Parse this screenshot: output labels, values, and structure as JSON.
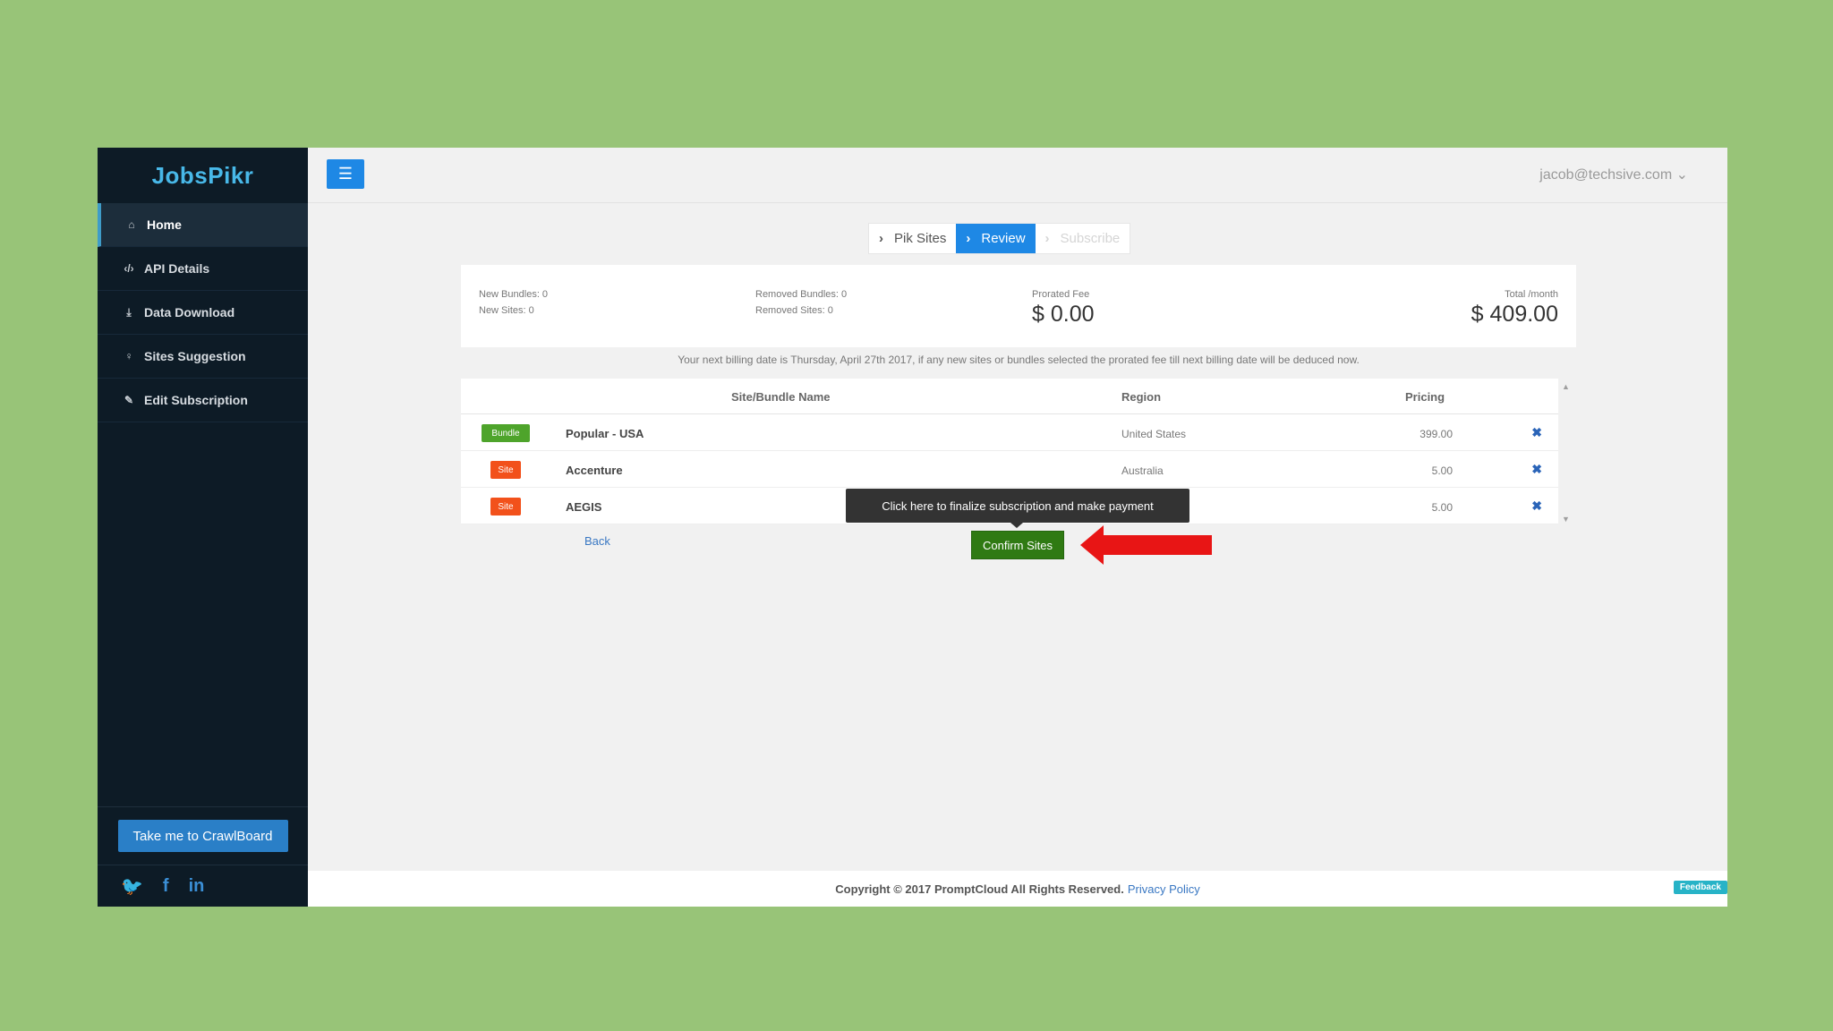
{
  "sidebar": {
    "logo": "JobsPikr",
    "items": [
      {
        "label": "Home",
        "icon": "home-icon",
        "glyph": "⌂"
      },
      {
        "label": "API Details",
        "icon": "code-icon",
        "glyph": "‹/›"
      },
      {
        "label": "Data Download",
        "icon": "download-icon",
        "glyph": "⤓"
      },
      {
        "label": "Sites Suggestion",
        "icon": "lightbulb-icon",
        "glyph": "♀"
      },
      {
        "label": "Edit Subscription",
        "icon": "edit-icon",
        "glyph": "✎"
      }
    ],
    "crawlboard_button": "Take me to CrawlBoard",
    "social": {
      "twitter": "🐦",
      "facebook": "f",
      "linkedin": "in"
    }
  },
  "topbar": {
    "menu_icon": "☰",
    "user": "jacob@techsive.com ⌄"
  },
  "steps": [
    {
      "label": "Pik Sites",
      "state": "done"
    },
    {
      "label": "Review",
      "state": "active"
    },
    {
      "label": "Subscribe",
      "state": "disabled"
    }
  ],
  "summary": {
    "new_bundles": "New Bundles: 0",
    "new_sites": "New Sites: 0",
    "removed_bundles": "Removed Bundles: 0",
    "removed_sites": "Removed Sites: 0",
    "prorated_label": "Prorated Fee",
    "prorated_value": "$ 0.00",
    "total_label": "Total /month",
    "total_value": "$ 409.00"
  },
  "billing_note": "Your next billing date is Thursday, April 27th 2017, if any new sites or bundles selected the prorated fee till next billing date will be deduced now.",
  "table": {
    "headers": {
      "name": "Site/Bundle Name",
      "region": "Region",
      "pricing": "Pricing"
    },
    "rows": [
      {
        "type": "Bundle",
        "name": "Popular - USA",
        "region": "United States",
        "price": "399.00",
        "remove": "✖"
      },
      {
        "type": "Site",
        "name": "Accenture",
        "region": "Australia",
        "price": "5.00",
        "remove": "✖"
      },
      {
        "type": "Site",
        "name": "AEGIS",
        "region": "",
        "price": "5.00",
        "remove": "✖"
      }
    ]
  },
  "actions": {
    "back": "Back",
    "confirm": "Confirm Sites",
    "tooltip": "Click here to finalize subscription and make payment"
  },
  "footer": {
    "copyright": "Copyright © 2017 PromptCloud All Rights Reserved.",
    "privacy": "Privacy Policy",
    "feedback": "Feedback"
  },
  "colors": {
    "background": "#98c478",
    "sidebar": "#0d1b26",
    "primary": "#1e88e5",
    "confirm": "#2f7a13",
    "bundle_badge": "#4ea42b",
    "site_badge": "#f2511b",
    "annotation_arrow": "#e81515"
  }
}
